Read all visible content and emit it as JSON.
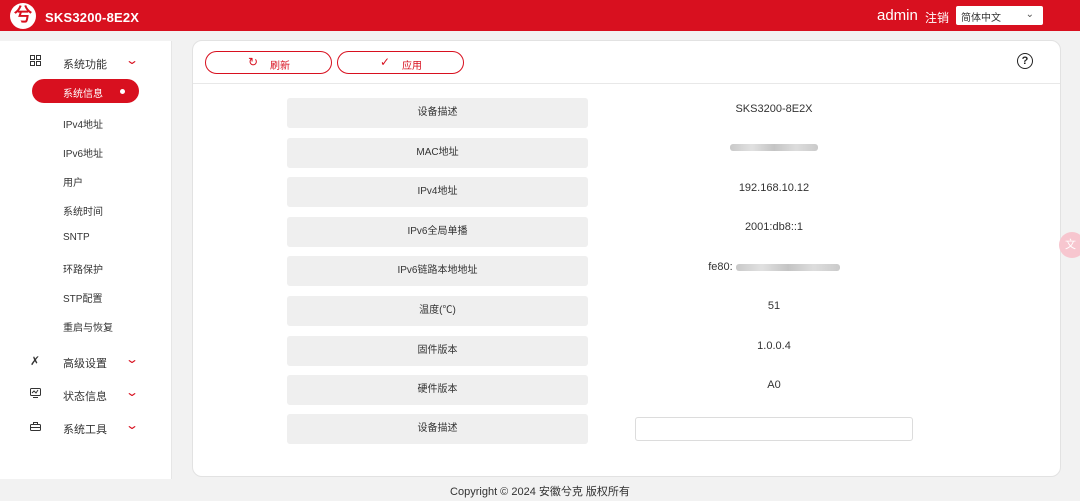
{
  "header": {
    "logo_glyph": "兮",
    "model": "SKS3200-8E2X",
    "user": "admin",
    "logout": "注销",
    "language": "简体中文",
    "accent_color": "#d8101f"
  },
  "sidebar": {
    "groups": [
      {
        "label": "系统功能",
        "icon": "grid-icon"
      },
      {
        "label": "高级设置",
        "icon": "tools-icon"
      },
      {
        "label": "状态信息",
        "icon": "monitor-icon"
      },
      {
        "label": "系统工具",
        "icon": "toolbox-icon"
      }
    ],
    "sub_items": [
      "系统信息",
      "IPv4地址",
      "IPv6地址",
      "用户",
      "系统时间",
      "SNTP",
      "环路保护",
      "STP配置",
      "重启与恢复"
    ],
    "active_item": "系统信息"
  },
  "toolbar": {
    "refresh_label": "刷新",
    "apply_label": "应用"
  },
  "info_rows": [
    {
      "label": "设备描述",
      "value": "SKS3200-8E2X"
    },
    {
      "label": "MAC地址",
      "value": ""
    },
    {
      "label": "IPv4地址",
      "value": "192.168.10.12"
    },
    {
      "label": "IPv6全局单播",
      "value": "2001:db8::1"
    },
    {
      "label": "IPv6链路本地地址",
      "value": "fe80:"
    },
    {
      "label": "温度(℃)",
      "value": "51"
    },
    {
      "label": "固件版本",
      "value": "1.0.0.4"
    },
    {
      "label": "硬件版本",
      "value": "A0"
    },
    {
      "label": "设备描述",
      "value": ""
    }
  ],
  "footer": "Copyright © 2024 安徽兮克 版权所有"
}
